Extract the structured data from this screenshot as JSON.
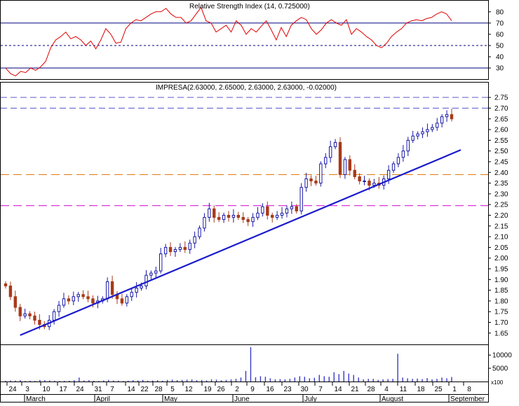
{
  "colors": {
    "up": "#1a1aa8",
    "down": "#a83a1a",
    "rsi": "#e00000",
    "trend": "#1a1acc",
    "resistance": "#e07000",
    "support": "#d000d0",
    "dash_blue": "#5a5ad0",
    "volume": "#3a3ac8",
    "frame": "#000000"
  },
  "rsi_panel": {
    "header": "Relative Strength Index (14, 0.725000)",
    "yticks": [
      "80",
      "70",
      "60",
      "50",
      "40",
      "30"
    ],
    "levels": {
      "upper": 70,
      "mid": 50,
      "lower": 30
    }
  },
  "price_panel": {
    "header": "IMPRESA(2.63000, 2.65000, 2.63000, 2.63000, -0.02000)",
    "yticks": [
      "2.75",
      "2.70",
      "2.65",
      "2.60",
      "2.55",
      "2.50",
      "2.45",
      "2.40",
      "2.35",
      "2.30",
      "2.25",
      "2.20",
      "2.15",
      "2.10",
      "2.05",
      "2.00",
      "1.95",
      "1.90",
      "1.85",
      "1.80",
      "1.75",
      "1.70",
      "1.65"
    ],
    "hlines": [
      {
        "price": 2.75,
        "kind": "dash_blue"
      },
      {
        "price": 2.7,
        "kind": "dash_blue"
      },
      {
        "price": 2.39,
        "kind": "resistance"
      },
      {
        "price": 2.245,
        "kind": "support"
      }
    ],
    "trendline": {
      "from": {
        "index": 3,
        "price": 1.64
      },
      "to": {
        "index": 96,
        "price": 2.505
      }
    }
  },
  "volume_panel": {
    "yticks": [
      "10000",
      "5000"
    ],
    "unit": "x100"
  },
  "x_axis": {
    "day_labels": [
      "24",
      "3",
      "10",
      "17",
      "24",
      "31",
      "7",
      "14",
      "22",
      "28",
      "5",
      "12",
      "19",
      "26",
      "2",
      "9",
      "16",
      "23",
      "30",
      "7",
      "14",
      "21",
      "28",
      "4",
      "11",
      "18",
      "25",
      "1",
      "8"
    ],
    "month_labels": [
      "March",
      "April",
      "May",
      "June",
      "July",
      "August",
      "September"
    ]
  },
  "chart_data": {
    "type": "candlestick",
    "title": "IMPRESA(2.63000, 2.65000, 2.63000, 2.63000, -0.02000)",
    "series": [
      {
        "name": "IMPRESA",
        "values": [
          1.87,
          1.82,
          1.77,
          1.73,
          1.74,
          1.73,
          1.71,
          1.69,
          1.68,
          1.71,
          1.75,
          1.78,
          1.81,
          1.8,
          1.82,
          1.83,
          1.82,
          1.81,
          1.79,
          1.8,
          1.81,
          1.89,
          1.83,
          1.81,
          1.79,
          1.82,
          1.84,
          1.86,
          1.87,
          1.92,
          1.93,
          1.94,
          2.02,
          2.05,
          2.03,
          2.04,
          2.05,
          2.04,
          2.07,
          2.1,
          2.14,
          2.19,
          2.23,
          2.19,
          2.18,
          2.2,
          2.19,
          2.2,
          2.19,
          2.18,
          2.17,
          2.19,
          2.21,
          2.24,
          2.2,
          2.19,
          2.2,
          2.21,
          2.23,
          2.24,
          2.22,
          2.33,
          2.37,
          2.36,
          2.35,
          2.44,
          2.47,
          2.52,
          2.54,
          2.39,
          2.46,
          2.41,
          2.38,
          2.36,
          2.36,
          2.34,
          2.35,
          2.34,
          2.37,
          2.41,
          2.44,
          2.47,
          2.5,
          2.55,
          2.57,
          2.58,
          2.59,
          2.6,
          2.61,
          2.63,
          2.66,
          2.67,
          2.65
        ]
      },
      {
        "name": "Relative Strength Index",
        "values": [
          30,
          25,
          23,
          27,
          26,
          30,
          28,
          31,
          36,
          48,
          55,
          58,
          62,
          56,
          58,
          55,
          50,
          54,
          47,
          55,
          65,
          60,
          52,
          53,
          65,
          70,
          73,
          72,
          75,
          78,
          80,
          80,
          83,
          78,
          75,
          75,
          70,
          72,
          78,
          84,
          72,
          70,
          62,
          65,
          68,
          62,
          72,
          68,
          60,
          65,
          62,
          67,
          72,
          64,
          55,
          66,
          58,
          68,
          72,
          75,
          73,
          65,
          60,
          64,
          70,
          73,
          70,
          68,
          73,
          60,
          65,
          62,
          58,
          55,
          50,
          48,
          52,
          58,
          62,
          65,
          70,
          72,
          73,
          72,
          74,
          75,
          78,
          80,
          78,
          72
        ]
      },
      {
        "name": "Volume",
        "values": [
          300,
          400,
          350,
          500,
          200,
          300,
          250,
          600,
          500,
          400,
          300,
          200,
          250,
          300,
          500,
          1500,
          400,
          500,
          300,
          200,
          400,
          600,
          400,
          300,
          200,
          300,
          500,
          400,
          600,
          300,
          400,
          500,
          300,
          600,
          700,
          500,
          600,
          700,
          800,
          500,
          600,
          400,
          800,
          700,
          500,
          600,
          800,
          1000,
          1500,
          4000,
          13000,
          1600,
          2000,
          1800,
          1200,
          800,
          900,
          800,
          1000,
          1500,
          2000,
          1800,
          1200,
          1400,
          2500,
          2000,
          1800,
          3500,
          2800,
          4000,
          3000,
          2500,
          1500,
          800,
          1000,
          1000,
          600,
          800,
          900,
          1000,
          10500,
          1500,
          1200,
          1000,
          1100,
          900,
          1300,
          800,
          1000,
          1500,
          1200,
          1700
        ]
      }
    ],
    "ylim": [
      1.62,
      2.78
    ],
    "rsi_ylim": [
      22,
      88
    ],
    "grid": false
  }
}
